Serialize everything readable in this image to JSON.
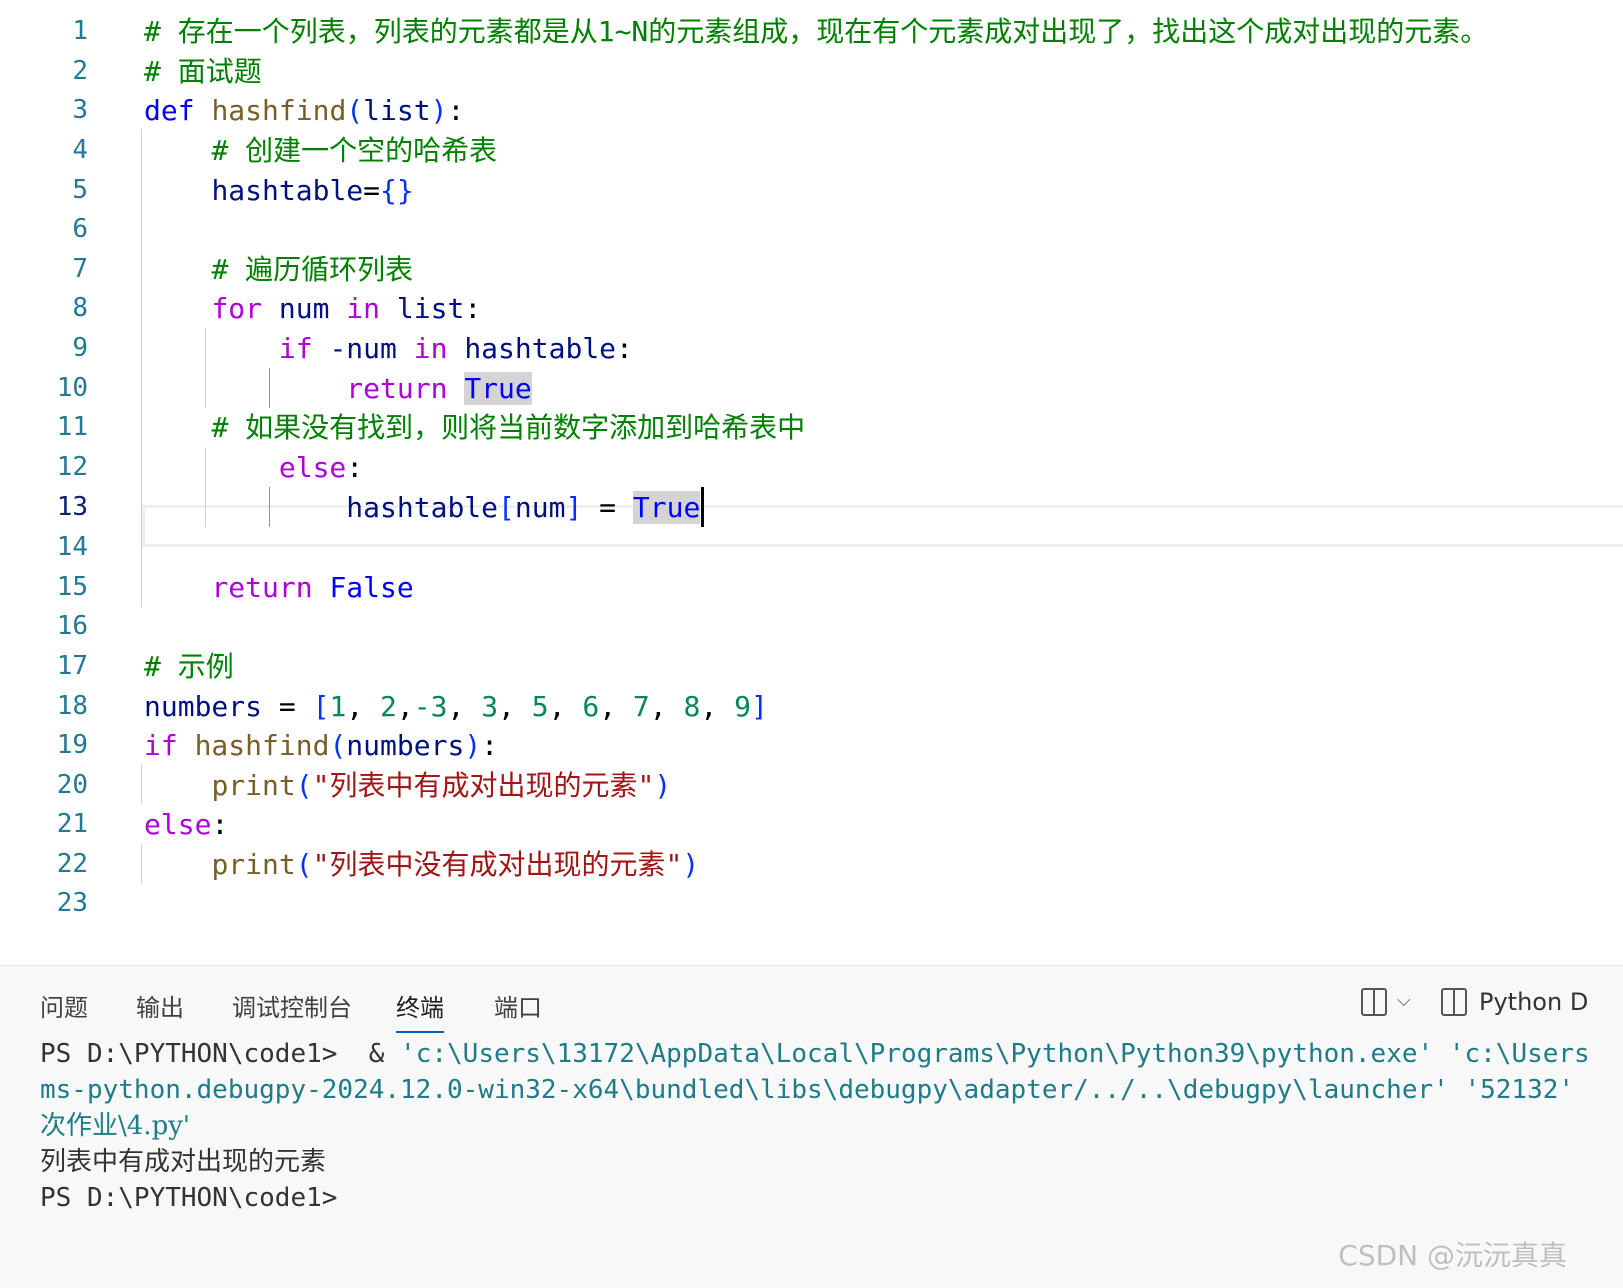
{
  "editor": {
    "active_line": 13,
    "lines": [
      {
        "n": "1",
        "comment": "# 存在一个列表，列表的元素都是从1~N的元素组成，现在有个元素成对出现了，找出这个成对出现的元素。"
      },
      {
        "n": "2",
        "comment": "# 面试题"
      },
      {
        "n": "3",
        "kw": "def",
        "fn": "hashfind",
        "open": "(",
        "param": "list",
        "close": ")",
        "colon": ":"
      },
      {
        "n": "4",
        "comment": "# 创建一个空的哈希表"
      },
      {
        "n": "5",
        "var": "hashtable",
        "eq": "=",
        "braces": "{}"
      },
      {
        "n": "6"
      },
      {
        "n": "7",
        "comment": "# 遍历循环列表"
      },
      {
        "n": "8",
        "kw": "for",
        "var": "num",
        "kw_in": "in",
        "var2": "list",
        "colon": ":"
      },
      {
        "n": "9",
        "kw": "if",
        "neg": "-num",
        "kw_in": "in",
        "var2": "hashtable",
        "colon": ":"
      },
      {
        "n": "10",
        "kw": "return",
        "const": "True"
      },
      {
        "n": "11",
        "comment": "# 如果没有找到，则将当前数字添加到哈希表中"
      },
      {
        "n": "12",
        "kw": "else",
        "colon": ":"
      },
      {
        "n": "13",
        "var": "hashtable",
        "open": "[",
        "idx": "num",
        "close": "]",
        "eq": " = ",
        "const": "True"
      },
      {
        "n": "14"
      },
      {
        "n": "15",
        "kw": "return",
        "const": "False"
      },
      {
        "n": "16"
      },
      {
        "n": "17",
        "comment": "# 示例"
      },
      {
        "n": "18",
        "var": "numbers",
        "eq": " = ",
        "open": "[",
        "list_items": [
          "1",
          ", ",
          "2",
          ",",
          "-3",
          ", ",
          "3",
          ", ",
          "5",
          ", ",
          "6",
          ", ",
          "7",
          ", ",
          "8",
          ", ",
          "9"
        ],
        "close": "]"
      },
      {
        "n": "19",
        "kw": "if",
        "fn": "hashfind",
        "open": "(",
        "param": "numbers",
        "close": ")",
        "colon": ":"
      },
      {
        "n": "20",
        "fn": "print",
        "open": "(",
        "str": "\"列表中有成对出现的元素\"",
        "close": ")"
      },
      {
        "n": "21",
        "kw": "else",
        "colon": ":"
      },
      {
        "n": "22",
        "fn": "print",
        "open": "(",
        "str": "\"列表中没有成对出现的元素\"",
        "close": ")"
      },
      {
        "n": "23"
      }
    ]
  },
  "panel": {
    "tabs": [
      "问题",
      "输出",
      "调试控制台",
      "终端",
      "端口"
    ],
    "active_tab": "终端",
    "actions": {
      "split_icon": "split-editor-icon",
      "dropdown_icon": "chevron-down-icon",
      "terminal_icon": "terminal-split-icon",
      "terminal_label": "Python D"
    }
  },
  "terminal": {
    "line1_prompt": "PS D:\\PYTHON\\code1> ",
    "line1_amp": " & ",
    "line1_str1": "'c:\\Users\\13172\\AppData\\Local\\Programs\\Python\\Python39\\python.exe'",
    "line1_str2": " 'c:\\Users",
    "line2_str": "ms-python.debugpy-2024.12.0-win32-x64\\bundled\\libs\\debugpy\\adapter/../..\\debugpy\\launcher'",
    "line2_port": " '52132'",
    "line3_str": "次作业\\4.py'",
    "line4_output": "列表中有成对出现的元素",
    "line5_prompt": "PS D:\\PYTHON\\code1>"
  },
  "watermark": "CSDN @沅沅真真",
  "colors": {
    "keyword": "#af00db",
    "function": "#795e26",
    "variable": "#001080",
    "comment": "#008000",
    "number": "#098658",
    "string": "#a31515",
    "constant": "#0000ff",
    "line_number": "#237893",
    "tab_underline": "#005fb8"
  }
}
